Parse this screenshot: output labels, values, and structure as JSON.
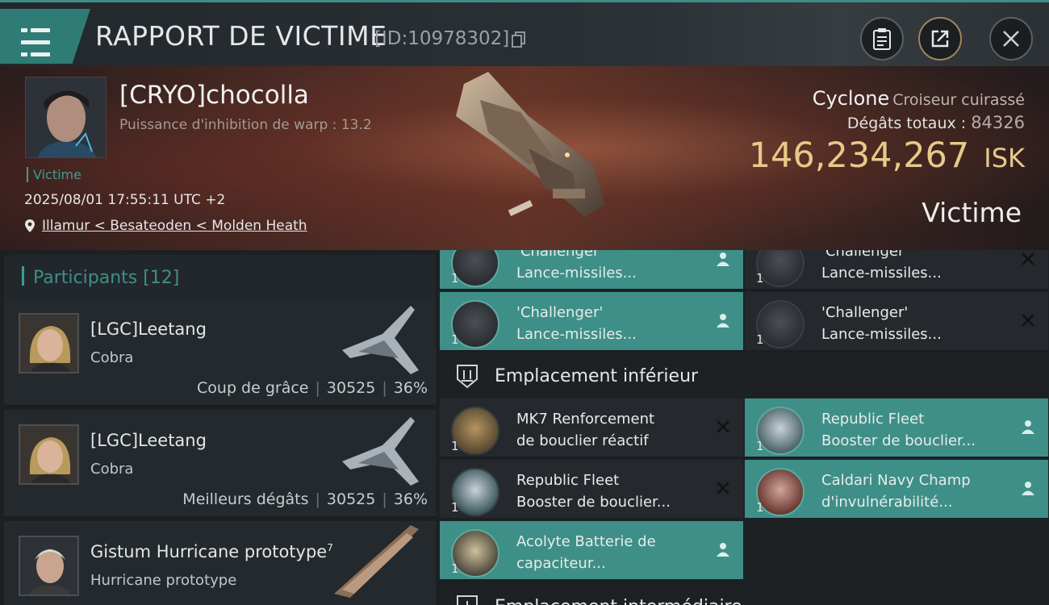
{
  "header": {
    "title": "RAPPORT DE VICTIME",
    "kill_id": "[ID:10978302]"
  },
  "victim": {
    "name": "[CRYO]chocolla",
    "warp_disruption": "Puissance d'inhibition de warp : 13.2",
    "role": "Victime",
    "datetime": "2025/08/01 17:55:11 UTC +2",
    "location": "Illamur < Besateoden < Molden Heath",
    "ship_name": "Cyclone",
    "ship_class": "Croiseur cuirassé",
    "damage_label": "Dégâts totaux :",
    "damage_value": "84326",
    "isk_value": "146,234,267",
    "isk_unit": "ISK",
    "status": "Victime"
  },
  "participants": {
    "label": "Participants [12]",
    "items": [
      {
        "name": "[LGC]Leetang",
        "ship": "Cobra",
        "tag": "Coup de grâce",
        "damage": "30525",
        "percent": "36%"
      },
      {
        "name": "[LGC]Leetang",
        "ship": "Cobra",
        "tag": "Meilleurs dégâts",
        "damage": "30525",
        "percent": "36%"
      },
      {
        "name": "Gistum Hurricane prototype",
        "sup": "7",
        "ship": "Hurricane prototype"
      }
    ]
  },
  "fittings": {
    "modules": [
      {
        "line1": "'Challenger'",
        "line2": "Lance-missiles...",
        "qty": "1"
      },
      {
        "line1": "'Challenger'",
        "line2": "Lance-missiles...",
        "qty": "1"
      },
      {
        "line1": "'Challenger'",
        "line2": "Lance-missiles...",
        "qty": "1"
      },
      {
        "line1": "'Challenger'",
        "line2": "Lance-missiles...",
        "qty": "1"
      },
      {
        "line1": "MK7 Renforcement",
        "line2": "de bouclier réactif",
        "qty": "1"
      },
      {
        "line1": "Republic Fleet",
        "line2": "Booster de bouclier...",
        "qty": "1"
      },
      {
        "line1": "Republic Fleet",
        "line2": "Booster de bouclier...",
        "qty": "1"
      },
      {
        "line1": "Caldari Navy Champ",
        "line2": "d'invulnérabilité...",
        "qty": "1"
      },
      {
        "line1": "Acolyte Batterie de",
        "line2": "capaciteur...",
        "qty": "1"
      }
    ],
    "sections": {
      "low": "Emplacement inférieur",
      "mid": "Emplacement intermédiaire"
    }
  },
  "colors": {
    "accent": "#3e8f87",
    "isk": "#e8c989",
    "teal_text": "#3d9d95"
  }
}
